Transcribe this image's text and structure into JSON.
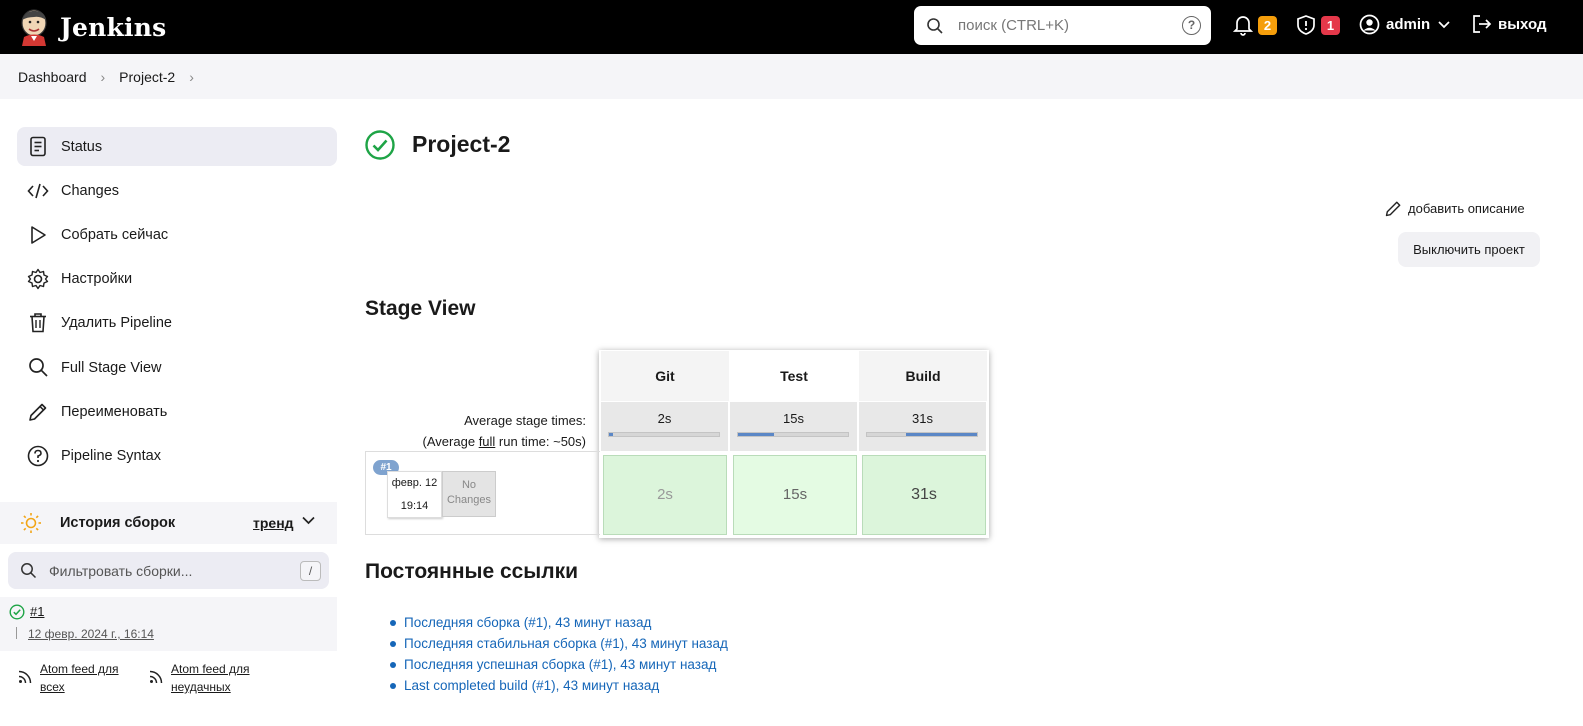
{
  "header": {
    "app_name": "Jenkins",
    "search_placeholder": "поиск (CTRL+K)",
    "notifications_count": "2",
    "security_count": "1",
    "user": "admin",
    "logout": "выход"
  },
  "breadcrumb": [
    "Dashboard",
    "Project-2"
  ],
  "sidebar": {
    "items": [
      {
        "label": "Status",
        "icon": "status-icon"
      },
      {
        "label": "Changes",
        "icon": "code-icon"
      },
      {
        "label": "Собрать сейчас",
        "icon": "play-icon"
      },
      {
        "label": "Настройки",
        "icon": "gear-icon"
      },
      {
        "label": "Удалить Pipeline",
        "icon": "trash-icon"
      },
      {
        "label": "Full Stage View",
        "icon": "search-icon"
      },
      {
        "label": "Переименовать",
        "icon": "pencil-icon"
      },
      {
        "label": "Pipeline Syntax",
        "icon": "help-icon"
      }
    ],
    "history": {
      "title": "История сборок",
      "trend": "тренд",
      "filter_placeholder": "Фильтровать сборки...",
      "filter_shortcut": "/",
      "builds": [
        {
          "number": "#1",
          "date": "12 февр. 2024 г., 16:14"
        }
      ],
      "feeds": [
        {
          "line1": "Atom feed для",
          "line2": "всех"
        },
        {
          "line1": "Atom feed для",
          "line2": "неудачных"
        }
      ]
    }
  },
  "main": {
    "project_title": "Project-2",
    "add_description": "добавить описание",
    "disable_project": "Выключить проект",
    "stage_view_title": "Stage View",
    "avg_stage_times_label": "Average stage times:",
    "avg_full_prefix": "(Average ",
    "avg_full_link": "full",
    "avg_full_suffix": " run time: ~50s)",
    "stages": [
      {
        "name": "Git",
        "avg": "2s",
        "avg_fraction": 0.04,
        "run": "2s"
      },
      {
        "name": "Test",
        "avg": "15s",
        "avg_fraction": 0.33,
        "run": "15s"
      },
      {
        "name": "Build",
        "avg": "31s",
        "avg_fraction": 0.65,
        "run": "31s"
      }
    ],
    "run": {
      "badge": "#1",
      "date": "февр. 12",
      "time": "19:14",
      "no_changes_1": "No",
      "no_changes_2": "Changes"
    },
    "permalinks_title": "Постоянные ссылки",
    "permalinks": [
      "Последняя сборка (#1), 43 минут назад",
      "Последняя стабильная сборка (#1), 43 минут назад",
      "Последняя успешная сборка (#1), 43 минут назад",
      "Last completed build (#1), 43 минут назад"
    ]
  }
}
